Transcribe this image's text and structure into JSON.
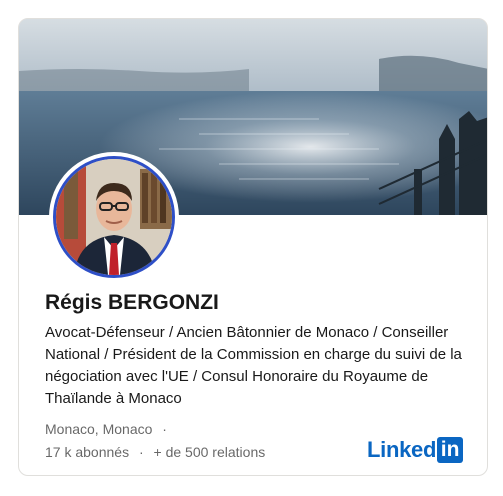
{
  "profile": {
    "name": "Régis BERGONZI",
    "headline": "Avocat-Défenseur / Ancien Bâtonnier de Monaco / Conseiller National / Président de la Commission en charge du suivi de la négociation avec l'UE / Consul Honoraire du Royaume de Thaïlande à Monaco",
    "location": "Monaco, Monaco",
    "followers": "17 k abonnés",
    "connections": "+ de 500 relations",
    "separator": "·"
  },
  "brand": {
    "wordmark": "Linked",
    "box_letters": "in",
    "color": "#0a66c2"
  },
  "banner": {
    "icon": "sea-landscape-photo"
  },
  "avatar": {
    "icon": "profile-photo",
    "ring_color": "#2e4fc7"
  }
}
